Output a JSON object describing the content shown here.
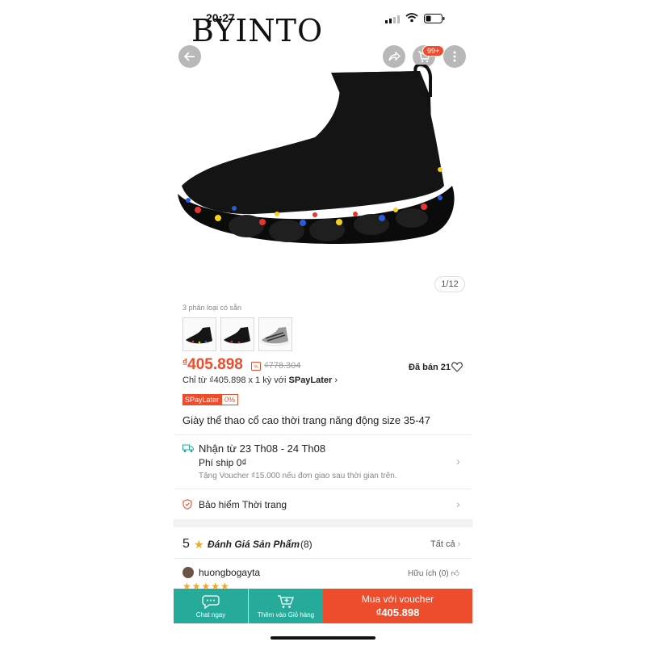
{
  "status": {
    "time": "20:27"
  },
  "watermark": "BYINTO",
  "header": {
    "cart_badge": "99+"
  },
  "gallery": {
    "counter": "1/12"
  },
  "variants": {
    "caption": "3 phân loại có sẵn"
  },
  "pricing": {
    "currency": "₫",
    "price": "405.898",
    "old_price": "₫778.304",
    "sold": "Đã bán 21",
    "installment_prefix": "Chỉ từ ₫405.898 x 1 kỳ với ",
    "installment_brand": "SPayLater",
    "spay_tag": "SPayLater",
    "spay_rate": "0%"
  },
  "product": {
    "title": "Giày thể thao cổ cao thời trang năng động size 35-47"
  },
  "shipping": {
    "delivery": "Nhận từ 23 Th08 - 24 Th08",
    "fee": "Phí ship 0₫",
    "voucher_note": "Tặng Voucher ₫15.000 nếu đơn giao sau thời gian trên."
  },
  "insurance": {
    "label": "Bảo hiểm Thời trang"
  },
  "reviews": {
    "score": "5",
    "title": "Đánh Giá Sản Phẩm",
    "count": "(8)",
    "see_all": "Tất cả",
    "first": {
      "user": "huongbogayta",
      "helpful": "Hữu ích (0)",
      "stars": "★★★★★"
    }
  },
  "bottom_bar": {
    "chat_label": "Chat ngay",
    "cart_label": "Thêm vào Giỏ hàng",
    "buy_label": "Mua với voucher",
    "buy_price": "₫405.898"
  },
  "colors": {
    "accent": "#ee4d2d",
    "teal": "#26aa99"
  }
}
